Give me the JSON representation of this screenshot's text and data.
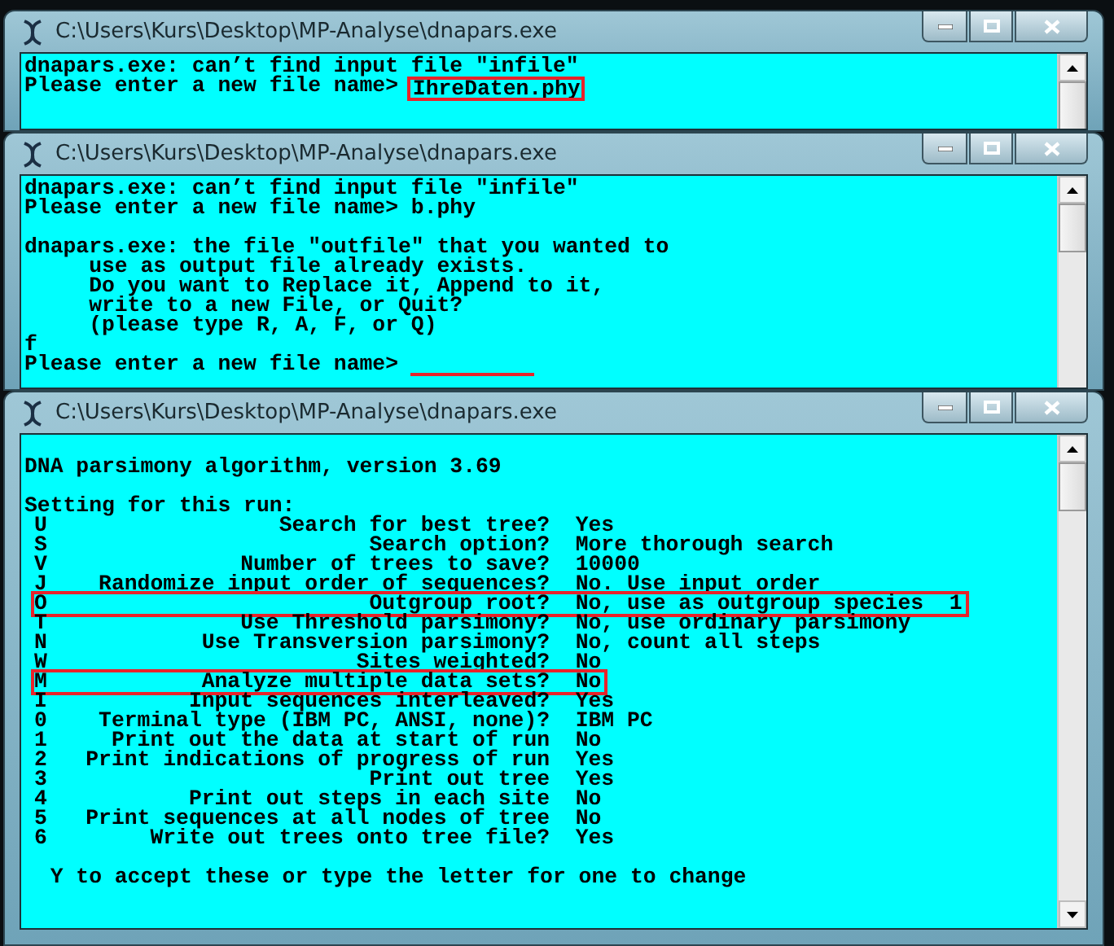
{
  "windows": [
    {
      "title": "C:\\Users\\Kurs\\Desktop\\MP-Analyse\\dnapars.exe",
      "bottom_scroll": false,
      "lines": [
        {
          "kind": "text",
          "text": "dnapars.exe: can’t find input file \"infile\""
        },
        {
          "kind": "input",
          "text": "Please enter a new file name> ",
          "value": "IhreDaten.phy",
          "highlighted": true
        }
      ]
    },
    {
      "title": "C:\\Users\\Kurs\\Desktop\\MP-Analyse\\dnapars.exe",
      "bottom_scroll": false,
      "lines": [
        {
          "kind": "text",
          "text": "dnapars.exe: can’t find input file \"infile\""
        },
        {
          "kind": "text",
          "text": "Please enter a new file name> b.phy"
        },
        {
          "kind": "blank"
        },
        {
          "kind": "text",
          "text": "dnapars.exe: the file \"outfile\" that you wanted to"
        },
        {
          "kind": "text",
          "text": "     use as output file already exists."
        },
        {
          "kind": "text",
          "text": "     Do you want to Replace it, Append to it,"
        },
        {
          "kind": "text",
          "text": "     write to a new File, or Quit?"
        },
        {
          "kind": "text",
          "text": "     (please type R, A, F, or Q)"
        },
        {
          "kind": "text",
          "text": "f"
        },
        {
          "kind": "underline",
          "text": "Please enter a new file name> "
        }
      ]
    },
    {
      "title": "C:\\Users\\Kurs\\Desktop\\MP-Analyse\\dnapars.exe",
      "bottom_scroll": true,
      "lines": [
        {
          "kind": "blank"
        },
        {
          "kind": "text",
          "text": "DNA parsimony algorithm, version 3.69"
        },
        {
          "kind": "blank"
        },
        {
          "kind": "text",
          "text": "Setting for this run:"
        },
        {
          "kind": "setting",
          "key": "U",
          "label": "Search for best tree?",
          "value": "Yes",
          "highlighted": false
        },
        {
          "kind": "setting",
          "key": "S",
          "label": "Search option?",
          "value": "More thorough search",
          "highlighted": false
        },
        {
          "kind": "setting",
          "key": "V",
          "label": "Number of trees to save?",
          "value": "10000",
          "highlighted": false
        },
        {
          "kind": "setting",
          "key": "J",
          "label": "Randomize input order of sequences?",
          "value": "No. Use input order",
          "highlighted": false
        },
        {
          "kind": "setting",
          "key": "O",
          "label": "Outgroup root?",
          "value": "No, use as outgroup species  1",
          "highlighted": true
        },
        {
          "kind": "setting",
          "key": "T",
          "label": "Use Threshold parsimony?",
          "value": "No, use ordinary parsimony",
          "highlighted": false
        },
        {
          "kind": "setting",
          "key": "N",
          "label": "Use Transversion parsimony?",
          "value": "No, count all steps",
          "highlighted": false
        },
        {
          "kind": "setting",
          "key": "W",
          "label": "Sites weighted?",
          "value": "No",
          "highlighted": false
        },
        {
          "kind": "setting",
          "key": "M",
          "label": "Analyze multiple data sets?",
          "value": "No",
          "highlighted": true
        },
        {
          "kind": "setting",
          "key": "I",
          "label": "Input sequences interleaved?",
          "value": "Yes",
          "highlighted": false
        },
        {
          "kind": "setting",
          "key": "0",
          "label": "Terminal type (IBM PC, ANSI, none)?",
          "value": "IBM PC",
          "highlighted": false
        },
        {
          "kind": "setting",
          "key": "1",
          "label": "Print out the data at start of run",
          "value": "No",
          "highlighted": false
        },
        {
          "kind": "setting",
          "key": "2",
          "label": "Print indications of progress of run",
          "value": "Yes",
          "highlighted": false
        },
        {
          "kind": "setting",
          "key": "3",
          "label": "Print out tree",
          "value": "Yes",
          "highlighted": false
        },
        {
          "kind": "setting",
          "key": "4",
          "label": "Print out steps in each site",
          "value": "No",
          "highlighted": false
        },
        {
          "kind": "setting",
          "key": "5",
          "label": "Print sequences at all nodes of tree",
          "value": "No",
          "highlighted": false
        },
        {
          "kind": "setting",
          "key": "6",
          "label": "Write out trees onto tree file?",
          "value": "Yes",
          "highlighted": false
        },
        {
          "kind": "blank"
        },
        {
          "kind": "text",
          "text": "  Y to accept these or type the letter for one to change"
        }
      ]
    }
  ]
}
